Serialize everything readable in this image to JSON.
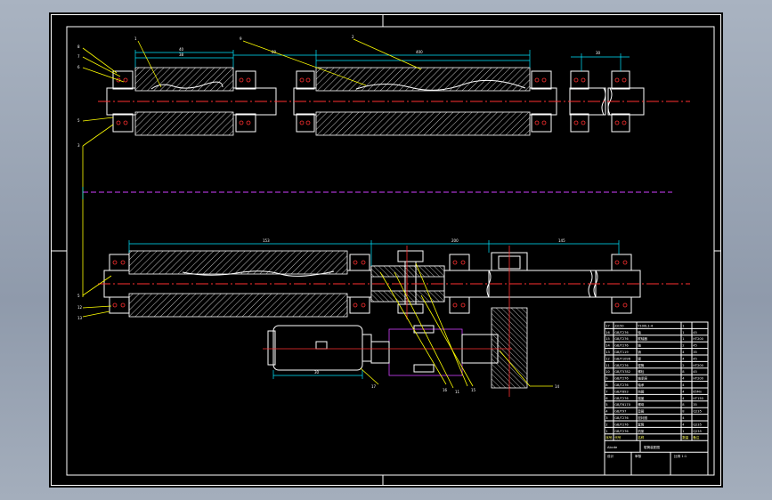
{
  "drawing": {
    "dims": {
      "roll_top_a": "40",
      "roll_top_b": "38",
      "roll_top_c": "80",
      "right_span": "400",
      "roll_bottom_total": "153",
      "mid_span": "200",
      "right_bottom_span": "145",
      "motor_len": "30"
    },
    "part_numbers": {
      "p1": "8",
      "p2": "7",
      "p3": "6",
      "p4": "5",
      "p5": "3",
      "p6": "1",
      "p7": "9",
      "p8": "2",
      "p9": "5",
      "p10": "12",
      "p11": "13",
      "p12": "16",
      "p13": "11",
      "p14": "15",
      "p15": "14",
      "p16": "17"
    }
  },
  "title_block": {
    "rows": [
      {
        "no": "17",
        "code": "ZJ150",
        "name": "Y100L1-4",
        "qty": "1",
        "note": ""
      },
      {
        "no": "16",
        "code": "GB/T276",
        "name": "轴",
        "qty": "1",
        "note": "45"
      },
      {
        "no": "15",
        "code": "GB/T276",
        "name": "联轴器",
        "qty": "1",
        "note": "HT200"
      },
      {
        "no": "14",
        "code": "GB/T276",
        "name": "轴",
        "qty": "2",
        "note": "45"
      },
      {
        "no": "13",
        "code": "GB/T119",
        "name": "销",
        "qty": "4",
        "note": "35"
      },
      {
        "no": "12",
        "code": "GB/T1096",
        "name": "键",
        "qty": "4",
        "note": "45"
      },
      {
        "no": "11",
        "code": "GB/T276",
        "name": "辊筒",
        "qty": "2",
        "note": "HT200"
      },
      {
        "no": "10",
        "code": "GB/T5782",
        "name": "螺栓",
        "qty": "8",
        "note": "45"
      },
      {
        "no": "9",
        "code": "GB/T276",
        "name": "轴承座",
        "qty": "4",
        "note": "HT200"
      },
      {
        "no": "8",
        "code": "GB/T276",
        "name": "轴承",
        "qty": "4",
        "note": ""
      },
      {
        "no": "7",
        "code": "GB/T893",
        "name": "挡圈",
        "qty": "4",
        "note": "65Mn"
      },
      {
        "no": "6",
        "code": "GB/T276",
        "name": "端盖",
        "qty": "4",
        "note": "HT150"
      },
      {
        "no": "5",
        "code": "GB/T6170",
        "name": "螺母",
        "qty": "8",
        "note": "35"
      },
      {
        "no": "4",
        "code": "GB/T97",
        "name": "垫圈",
        "qty": "8",
        "note": "Q235"
      },
      {
        "no": "3",
        "code": "GB/T276",
        "name": "密封圈",
        "qty": "4",
        "note": ""
      },
      {
        "no": "2",
        "code": "GB/T276",
        "name": "套筒",
        "qty": "4",
        "note": "Q235"
      },
      {
        "no": "1",
        "code": "GB/T276",
        "name": "机架",
        "qty": "1",
        "note": "Q235"
      }
    ],
    "header": {
      "no": "序号",
      "code": "代号",
      "name": "名称",
      "qty": "数量",
      "note": "备注"
    },
    "signature": "Abcde",
    "title_name": "辊筒装配图",
    "footer_left": "设计",
    "footer_mid": "审核",
    "footer_right": "比例 1:1"
  }
}
